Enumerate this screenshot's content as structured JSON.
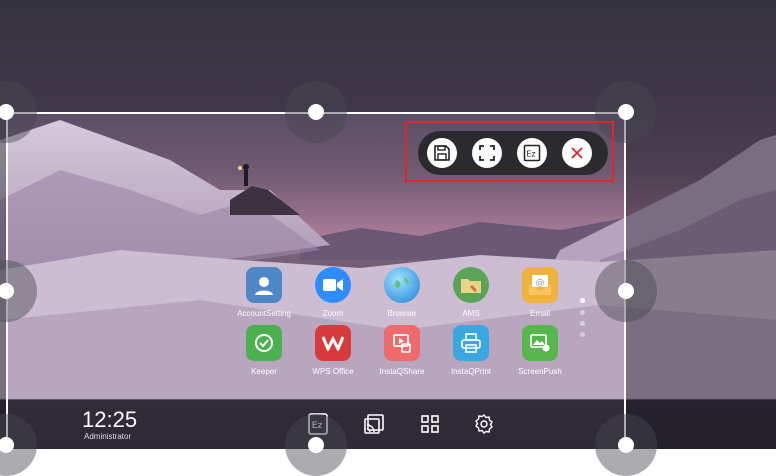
{
  "toolbar": {
    "buttons": [
      {
        "name": "save",
        "icon": "floppy-disk-icon"
      },
      {
        "name": "fullscreen",
        "icon": "fullscreen-corners-icon"
      },
      {
        "name": "annotate",
        "icon": "ez-write-icon"
      },
      {
        "name": "close",
        "icon": "close-x-icon"
      }
    ],
    "close_color": "#e0262b"
  },
  "apps": {
    "row1": [
      {
        "label": "AccountSetting",
        "icon": "account-icon"
      },
      {
        "label": "Zoom",
        "icon": "video-camera-icon"
      },
      {
        "label": "Browser",
        "icon": "globe-icon"
      },
      {
        "label": "AMS",
        "icon": "folder-icon"
      },
      {
        "label": "Email",
        "icon": "envelope-icon"
      }
    ],
    "row2": [
      {
        "label": "Keeper",
        "icon": "clock-check-icon"
      },
      {
        "label": "WPS Office",
        "icon": "wps-logo-icon"
      },
      {
        "label": "InstaQShare",
        "icon": "screen-share-icon"
      },
      {
        "label": "InstaQPrint",
        "icon": "printer-icon"
      },
      {
        "label": "ScreenPush",
        "icon": "image-push-icon"
      }
    ]
  },
  "taskbar": {
    "time": "12:25",
    "user": "Administrator",
    "icons": [
      "ez-write-icon",
      "cast-icon",
      "app-grid-icon",
      "settings-gear-icon"
    ]
  }
}
